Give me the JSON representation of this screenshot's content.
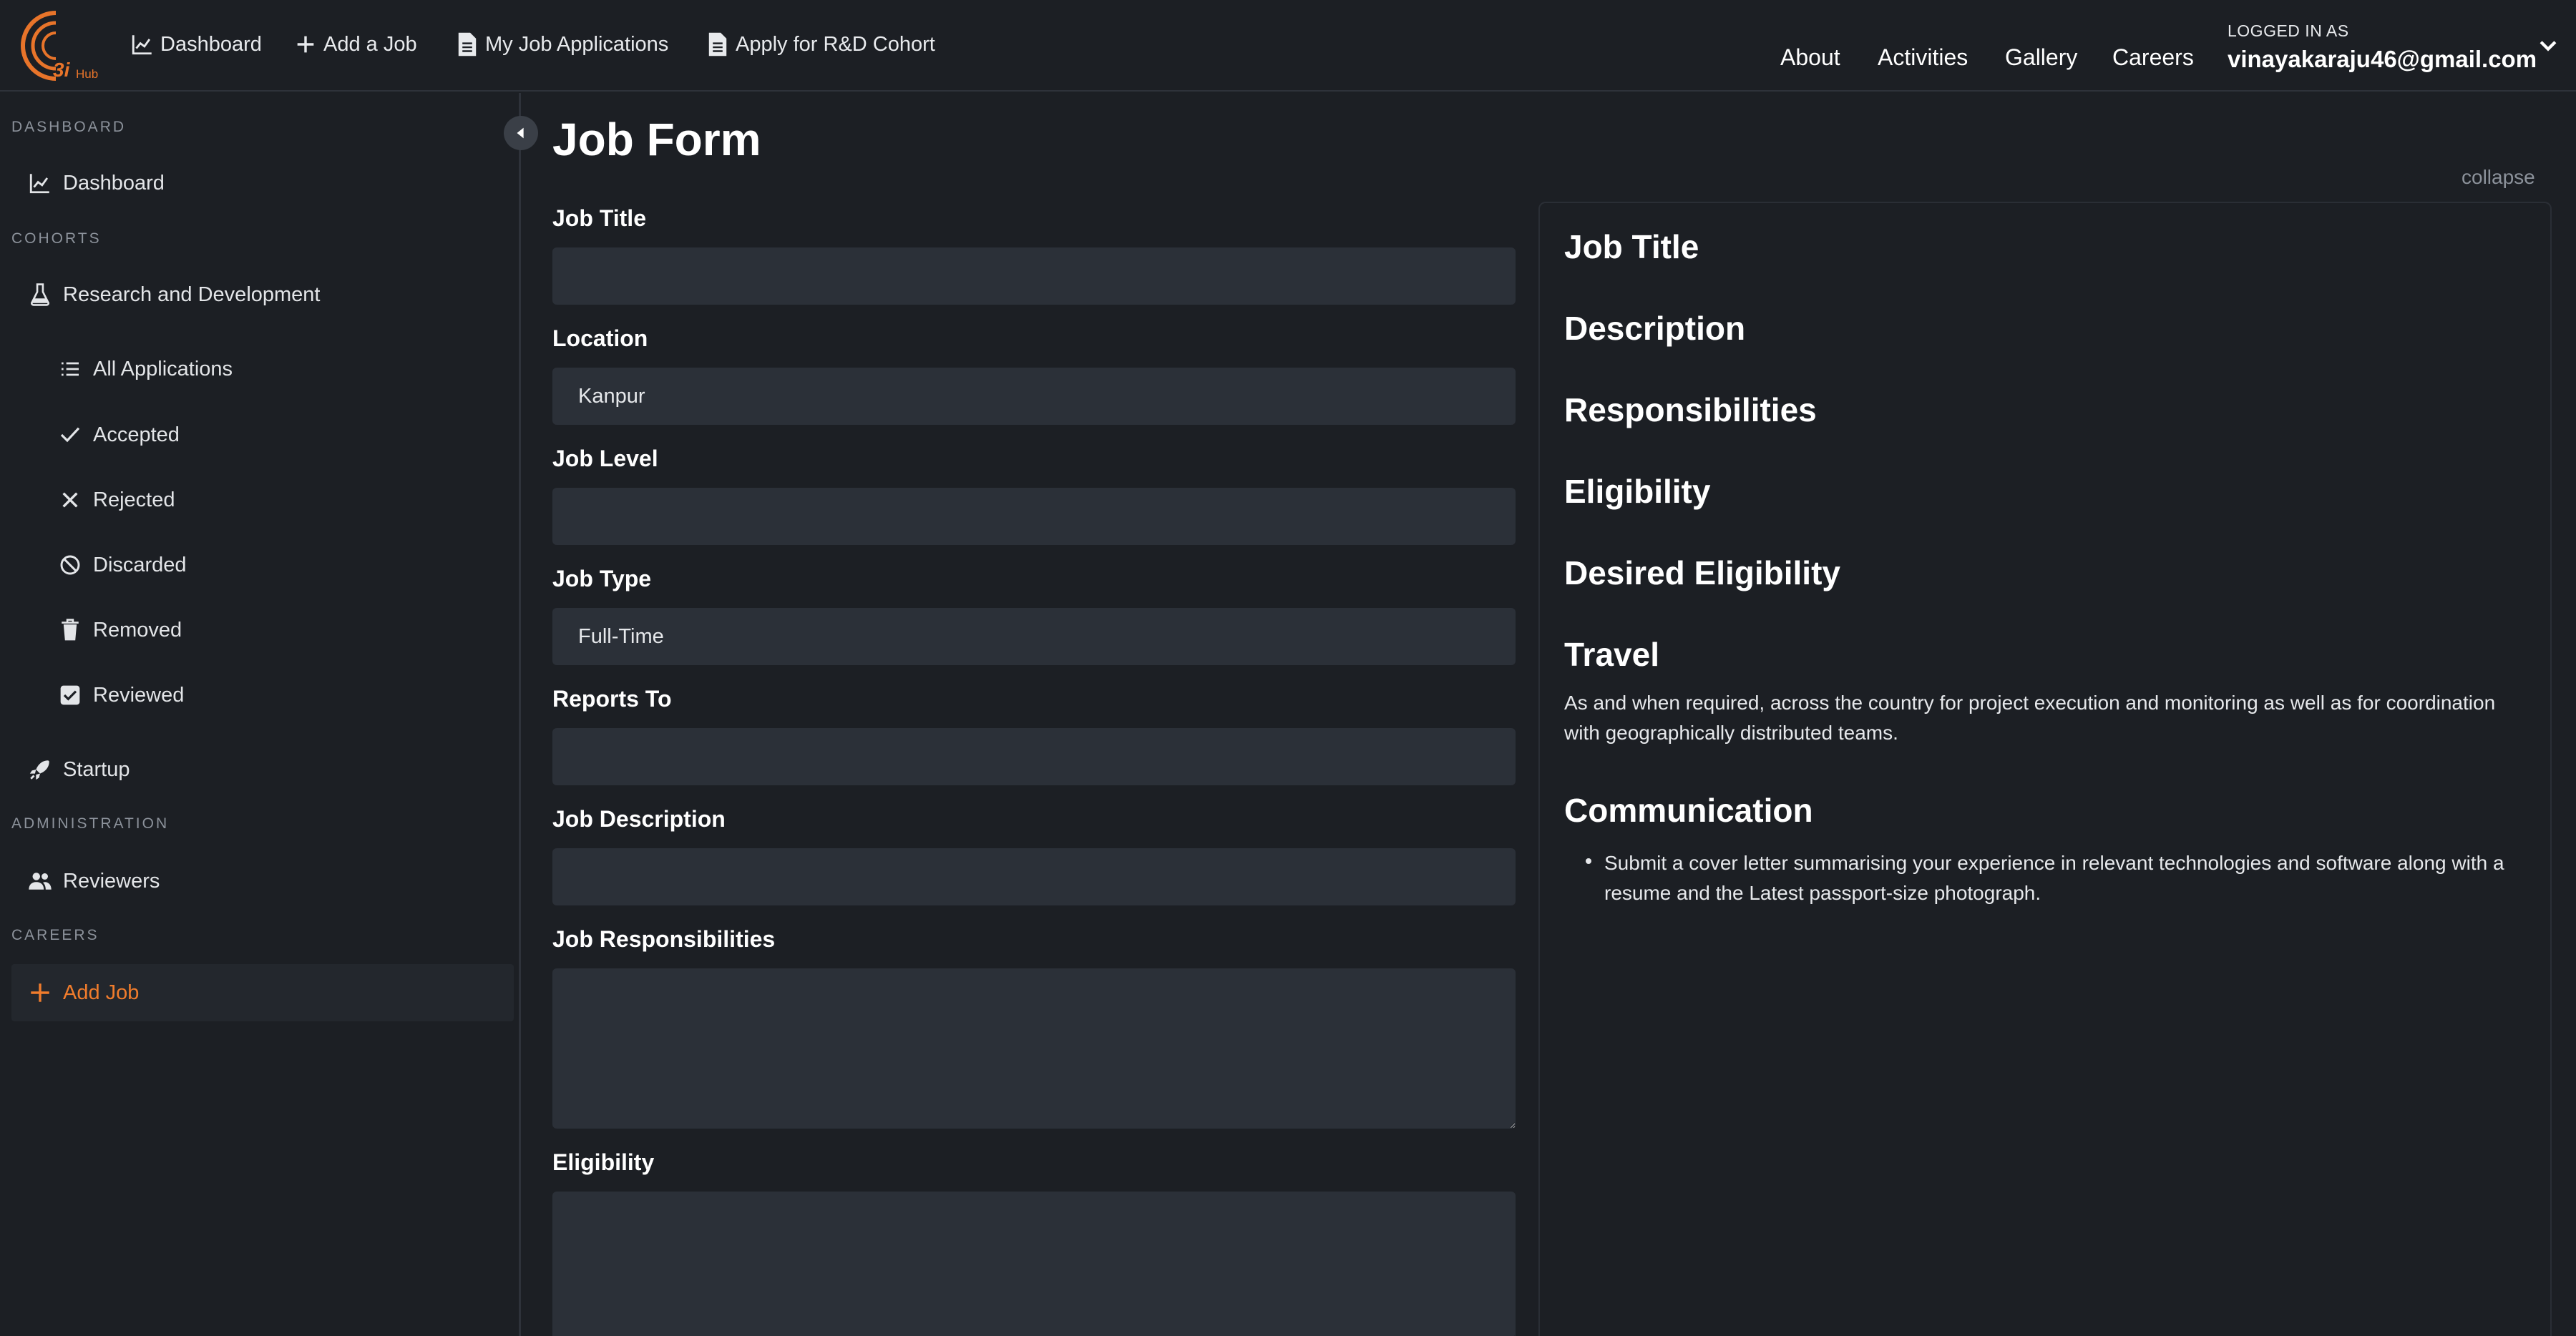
{
  "logo": {
    "text": "3i",
    "subtext": "Hub"
  },
  "topnav": {
    "dashboard": "Dashboard",
    "add_job": "Add a Job",
    "my_applications": "My Job Applications",
    "apply_cohort": "Apply for R&D Cohort"
  },
  "right_nav": {
    "about": "About",
    "activities": "Activities",
    "gallery": "Gallery",
    "careers": "Careers"
  },
  "user": {
    "logged_in_label": "LOGGED IN AS",
    "email": "vinayakaraju46@gmail.com"
  },
  "sidebar": {
    "section_dashboard": "DASHBOARD",
    "dashboard": "Dashboard",
    "section_cohorts": "COHORTS",
    "research": "Research and Development",
    "all_applications": "All Applications",
    "accepted": "Accepted",
    "rejected": "Rejected",
    "discarded": "Discarded",
    "removed": "Removed",
    "reviewed": "Reviewed",
    "startup": "Startup",
    "section_administration": "ADMINISTRATION",
    "reviewers": "Reviewers",
    "section_careers": "CAREERS",
    "add_job": "Add Job"
  },
  "form": {
    "title": "Job Form",
    "job_title_label": "Job Title",
    "job_title_value": "",
    "location_label": "Location",
    "location_value": "Kanpur",
    "job_level_label": "Job Level",
    "job_level_value": "",
    "job_type_label": "Job Type",
    "job_type_value": "Full-Time",
    "reports_to_label": "Reports To",
    "reports_to_value": "",
    "description_label": "Job Description",
    "description_value": "",
    "responsibilities_label": "Job Responsibilities",
    "responsibilities_value": "",
    "eligibility_label": "Eligibility",
    "eligibility_value": ""
  },
  "preview": {
    "collapse": "collapse",
    "job_title": "Job Title",
    "description": "Description",
    "responsibilities": "Responsibilities",
    "eligibility": "Eligibility",
    "desired_eligibility": "Desired Eligibility",
    "travel": "Travel",
    "travel_text": "As and when required, across the country for project execution and monitoring as well as for coordination with geographically distributed teams.",
    "communication": "Communication",
    "communication_item": "Submit a cover letter summarising your experience in relevant technologies and software along with a resume and the Latest passport-size photograph."
  },
  "colors": {
    "accent": "#f07c2c",
    "background": "#1c1f24",
    "field": "#2b3038"
  }
}
